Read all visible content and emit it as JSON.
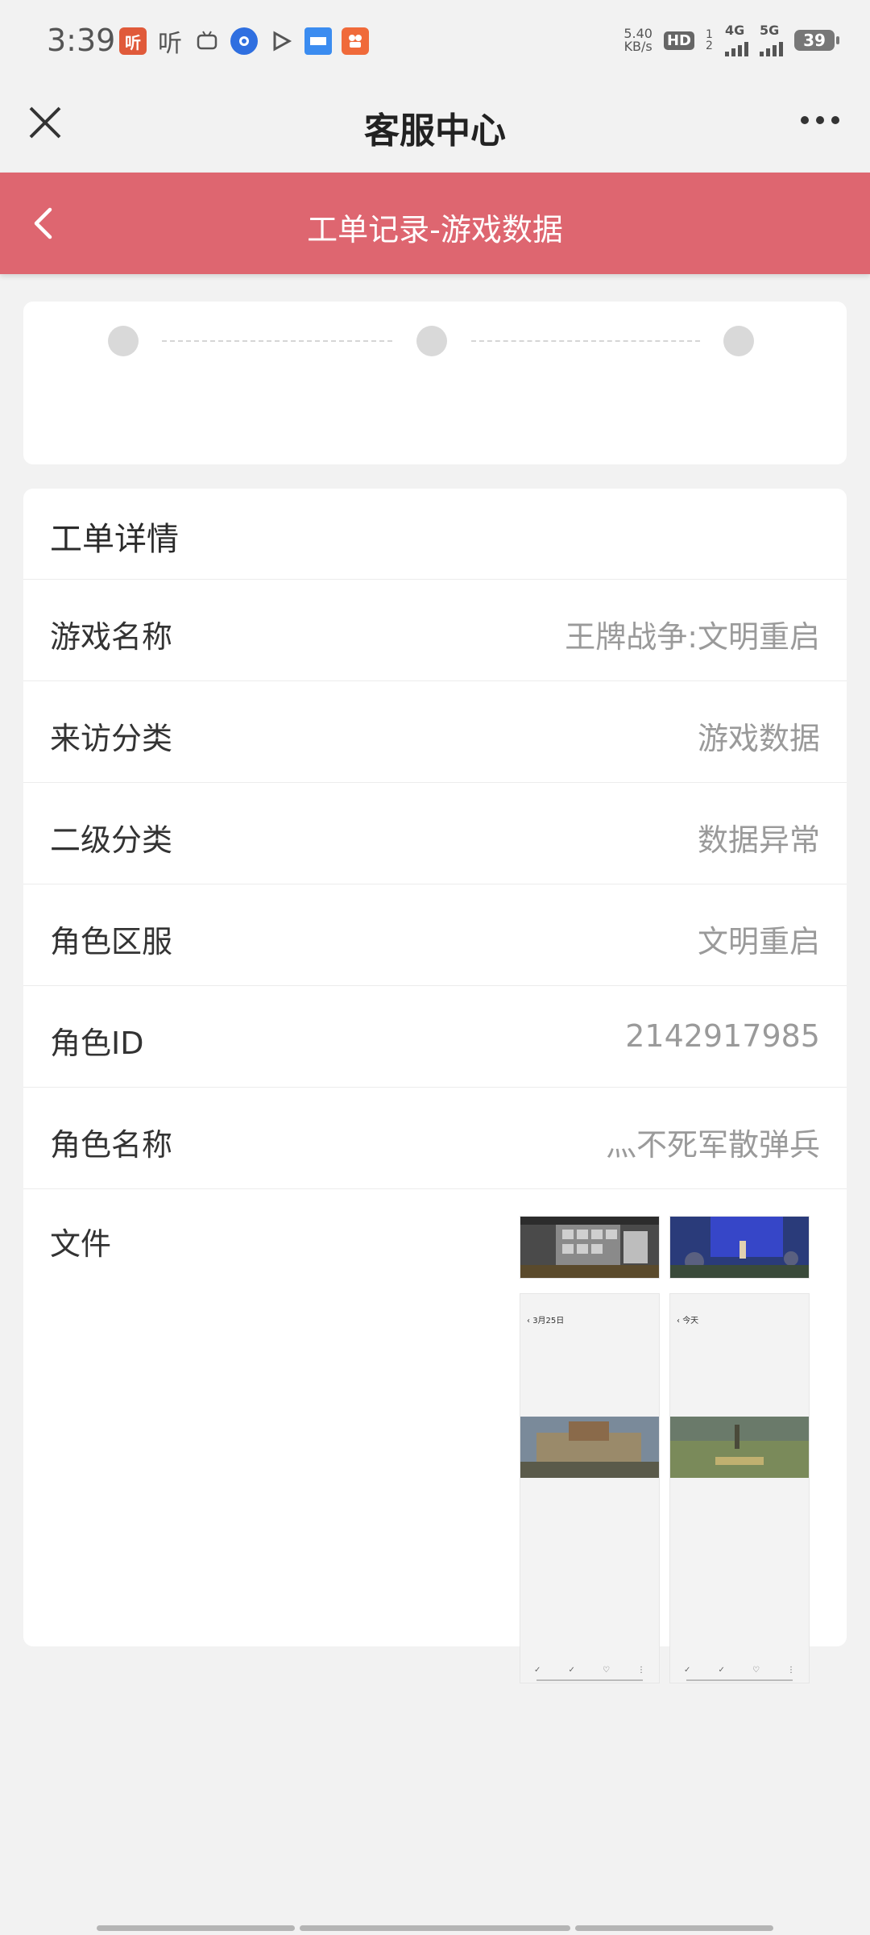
{
  "status_bar": {
    "time": "3:39",
    "net_speed_value": "5.40",
    "net_speed_unit": "KB/s",
    "hd_label": "HD",
    "sim_label": "1 2",
    "net1": "4G",
    "net2": "5G",
    "battery": "39"
  },
  "header": {
    "title": "客服中心"
  },
  "subheader": {
    "title": "工单记录-游戏数据"
  },
  "progress": {
    "steps": 3
  },
  "detail": {
    "heading": "工单详情",
    "rows": [
      {
        "label": "游戏名称",
        "value": "王牌战争:文明重启"
      },
      {
        "label": "来访分类",
        "value": "游戏数据"
      },
      {
        "label": "二级分类",
        "value": "数据异常"
      },
      {
        "label": "角色区服",
        "value": "文明重启"
      },
      {
        "label": "角色ID",
        "value": "2142917985"
      },
      {
        "label": "角色名称",
        "value": "灬不死军散弹兵"
      }
    ],
    "files_label": "文件",
    "attachments": [
      {
        "nav_text": "3月25日"
      },
      {
        "nav_text": "今天"
      }
    ]
  },
  "colors": {
    "accent_red": "#de6670",
    "background": "#f2f2f2"
  }
}
